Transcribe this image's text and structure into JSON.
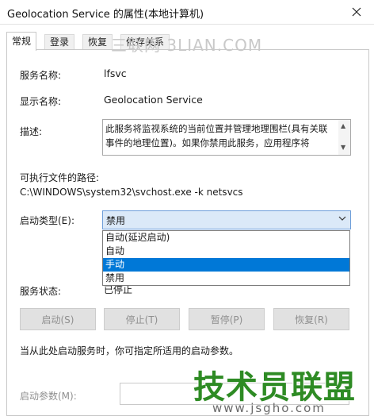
{
  "window": {
    "title": "Geolocation Service 的属性(本地计算机)"
  },
  "tabs": [
    {
      "label": "常规",
      "active": true
    },
    {
      "label": "登录",
      "active": false
    },
    {
      "label": "恢复",
      "active": false
    },
    {
      "label": "依存关系",
      "active": false
    }
  ],
  "watermark": "三联网 3LIAN.COM",
  "general": {
    "service_name_label": "服务名称:",
    "service_name": "lfsvc",
    "display_name_label": "显示名称:",
    "display_name": "Geolocation Service",
    "description_label": "描述:",
    "description": "此服务将监视系统的当前位置并管理地理围栏(具有关联事件的地理位置)。如果你禁用此服务，应用程序将",
    "exe_path_label": "可执行文件的路径:",
    "exe_path": "C:\\WINDOWS\\system32\\svchost.exe -k netsvcs",
    "startup_type_label": "启动类型(E):",
    "startup_type_value": "禁用",
    "startup_options": [
      "自动(延迟启动)",
      "自动",
      "手动",
      "禁用"
    ],
    "highlighted_option": "手动",
    "service_status_label": "服务状态:",
    "service_status": "已停止",
    "buttons": {
      "start": "启动(S)",
      "stop": "停止(T)",
      "pause": "暂停(P)",
      "resume": "恢复(R)"
    },
    "hint": "当从此处启动服务时，你可指定所适用的启动参数。",
    "start_params_label": "启动参数(M):",
    "start_params_value": ""
  },
  "overlay_logo": {
    "text": "技术员联盟",
    "url": "www.jsgho.com",
    "color": "#2e8b24"
  },
  "colors": {
    "selection": "#0078d7",
    "combo_focus": "#dbe9f8",
    "disabled_text": "#8f8f8f"
  }
}
